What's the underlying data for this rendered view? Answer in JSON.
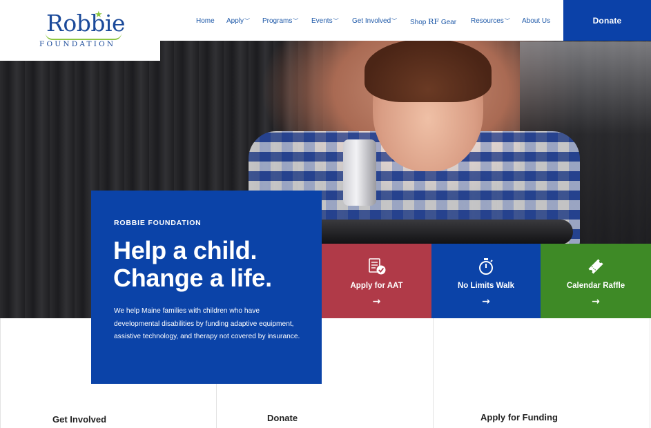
{
  "logo": {
    "name": "Robbie",
    "subtitle": "FOUNDATION"
  },
  "nav": {
    "items": [
      {
        "label": "Home",
        "dropdown": false
      },
      {
        "label": "Apply",
        "dropdown": true
      },
      {
        "label": "Programs",
        "dropdown": true
      },
      {
        "label": "Events",
        "dropdown": true
      },
      {
        "label": "Get Involved",
        "dropdown": true
      },
      {
        "label_pre": "Shop",
        "label_mark": "RF",
        "label_post": "Gear",
        "dropdown": false
      },
      {
        "label": "Resources",
        "dropdown": true
      },
      {
        "label": "About Us",
        "dropdown": false
      }
    ],
    "donate_label": "Donate"
  },
  "hero": {
    "eyebrow": "ROBBIE FOUNDATION",
    "headline_line1": "Help a child.",
    "headline_line2": "Change a life.",
    "body": "We help Maine families with children who have developmental disabilities by funding adaptive equipment, assistive technology, and therapy not covered by insurance."
  },
  "tiles": [
    {
      "label": "Apply for AAT",
      "icon": "checklist-icon",
      "color": "#b03a48",
      "arrow": "→"
    },
    {
      "label": "No Limits Walk",
      "icon": "stopwatch-icon",
      "color": "#0b43a8",
      "arrow": "→"
    },
    {
      "label": "Calendar Raffle",
      "icon": "ticket-icon",
      "color": "#3e8a26",
      "arrow": "→"
    }
  ],
  "cards": [
    {
      "title": "Get Involved"
    },
    {
      "title": "Donate"
    },
    {
      "title": "Apply for Funding"
    }
  ],
  "colors": {
    "brand_blue": "#0b43a8",
    "brand_green": "#8cc63f",
    "nav_text": "#1d58a8"
  }
}
